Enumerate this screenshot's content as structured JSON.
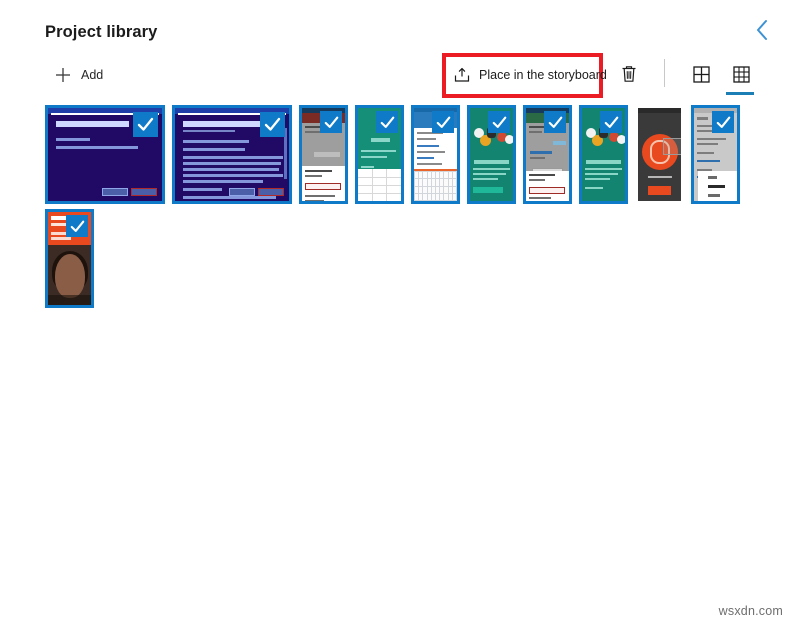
{
  "header": {
    "title": "Project library",
    "back_icon": "chevron-left-icon",
    "back_color": "#3d92d4"
  },
  "toolbar": {
    "add": {
      "label": "Add",
      "icon": "plus-icon"
    },
    "place": {
      "label": "Place in the storyboard",
      "icon": "place-in-storyboard-icon",
      "highlight": true,
      "highlight_color": "#ec1c24"
    },
    "delete": {
      "label": "Delete",
      "icon": "trash-icon"
    },
    "views": [
      {
        "name": "small-grid-view",
        "icon": "grid-2x2-icon",
        "selected": false
      },
      {
        "name": "large-grid-view",
        "icon": "grid-3x3-icon",
        "selected": true
      }
    ],
    "accent_color": "#1b7eb5"
  },
  "library": {
    "selection_color": "#0f7ac7",
    "check_icon": "checkmark-icon",
    "items": [
      {
        "name": "thumbnail-1",
        "kind": "wide",
        "art": "dlg",
        "selected": true
      },
      {
        "name": "thumbnail-2",
        "kind": "wide",
        "art": "dlg2",
        "selected": true
      },
      {
        "name": "thumbnail-3",
        "kind": "narrow",
        "art": "and",
        "selected": true
      },
      {
        "name": "thumbnail-4",
        "kind": "narrow",
        "art": "teal",
        "selected": true
      },
      {
        "name": "thumbnail-5",
        "kind": "narrow",
        "art": "wht",
        "selected": true
      },
      {
        "name": "thumbnail-6",
        "kind": "narrow",
        "art": "teal2",
        "selected": true
      },
      {
        "name": "thumbnail-7",
        "kind": "narrow",
        "art": "and2",
        "selected": true
      },
      {
        "name": "thumbnail-8",
        "kind": "narrow",
        "art": "teal2",
        "selected": true
      },
      {
        "name": "thumbnail-9",
        "kind": "narrow",
        "art": "drk",
        "selected": false
      },
      {
        "name": "thumbnail-10",
        "kind": "narrow",
        "art": "gry",
        "selected": true
      },
      {
        "name": "thumbnail-11",
        "kind": "narrow",
        "art": "ctc",
        "selected": true
      }
    ]
  },
  "watermark": {
    "text": "wsxdn.com"
  }
}
